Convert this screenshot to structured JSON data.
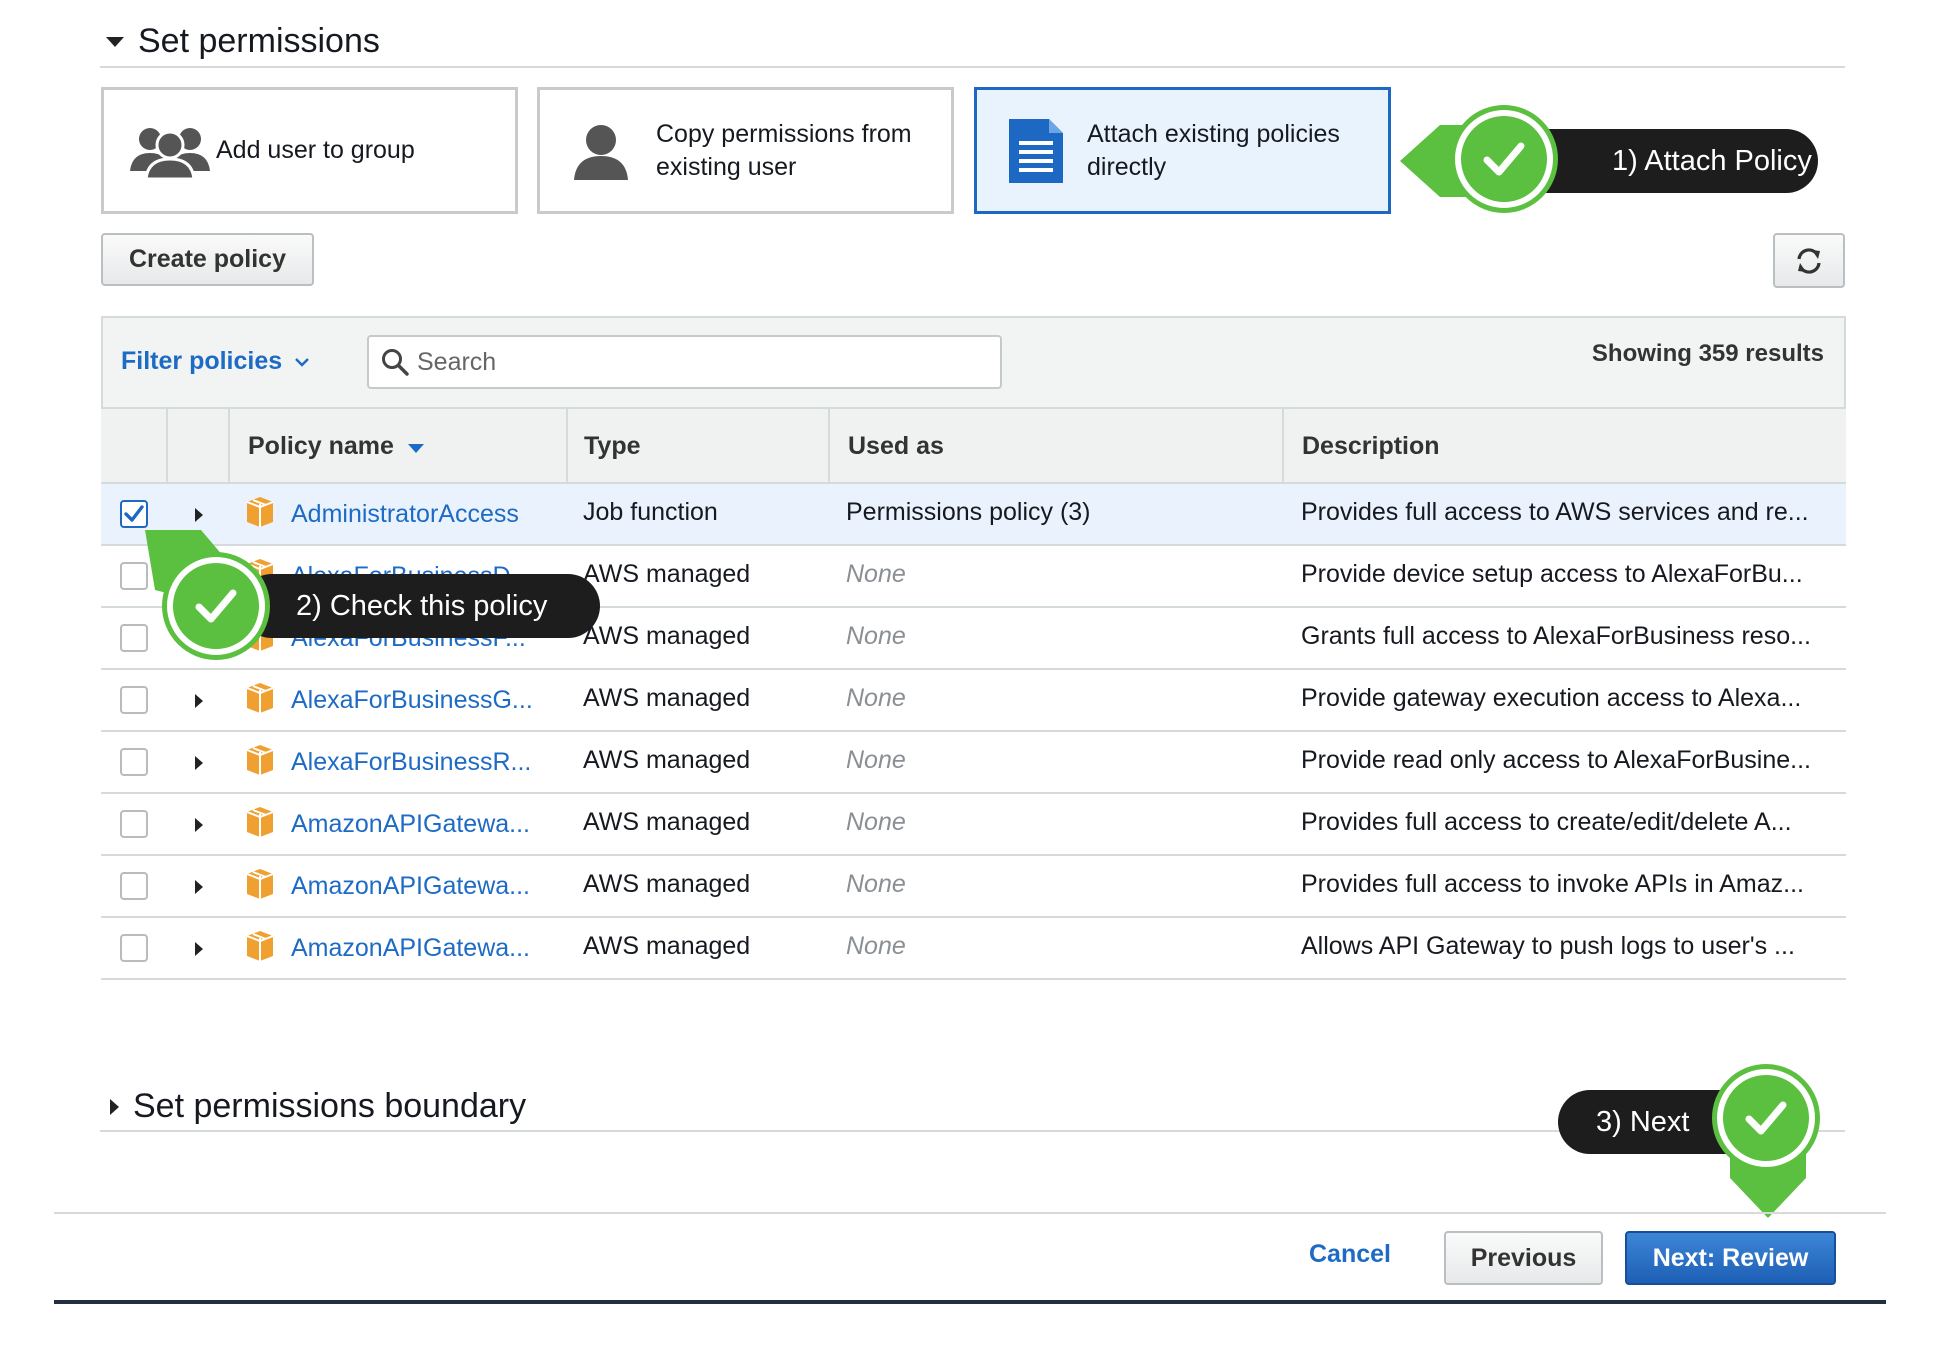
{
  "set_permissions": {
    "title": "Set permissions",
    "options": [
      {
        "label": "Add user to group",
        "icon": "group-icon",
        "selected": false
      },
      {
        "label_line1": "Copy permissions from",
        "label_line2": "existing user",
        "icon": "user-icon",
        "selected": false
      },
      {
        "label_line1": "Attach existing policies",
        "label_line2": "directly",
        "icon": "document-icon",
        "selected": true
      }
    ]
  },
  "toolbar": {
    "create_policy_label": "Create policy",
    "refresh_icon": "refresh-icon"
  },
  "filter": {
    "filter_label": "Filter policies",
    "search_placeholder": "Search",
    "results_text": "Showing 359 results"
  },
  "table": {
    "columns": [
      "Policy name",
      "Type",
      "Used as",
      "Description"
    ],
    "rows": [
      {
        "checked": true,
        "name": "AdministratorAccess",
        "type": "Job function",
        "used_as": "Permissions policy (3)",
        "used_none": false,
        "description": "Provides full access to AWS services and re..."
      },
      {
        "checked": false,
        "name": "AlexaForBusinessD...",
        "type": "AWS managed",
        "used_as": "None",
        "used_none": true,
        "description": "Provide device setup access to AlexaForBu..."
      },
      {
        "checked": false,
        "name": "AlexaForBusinessF...",
        "type": "AWS managed",
        "used_as": "None",
        "used_none": true,
        "description": "Grants full access to AlexaForBusiness reso..."
      },
      {
        "checked": false,
        "name": "AlexaForBusinessG...",
        "type": "AWS managed",
        "used_as": "None",
        "used_none": true,
        "description": "Provide gateway execution access to Alexa..."
      },
      {
        "checked": false,
        "name": "AlexaForBusinessR...",
        "type": "AWS managed",
        "used_as": "None",
        "used_none": true,
        "description": "Provide read only access to AlexaForBusine..."
      },
      {
        "checked": false,
        "name": "AmazonAPIGatewa...",
        "type": "AWS managed",
        "used_as": "None",
        "used_none": true,
        "description": "Provides full access to create/edit/delete A..."
      },
      {
        "checked": false,
        "name": "AmazonAPIGatewa...",
        "type": "AWS managed",
        "used_as": "None",
        "used_none": true,
        "description": "Provides full access to invoke APIs in Amaz..."
      },
      {
        "checked": false,
        "name": "AmazonAPIGatewa...",
        "type": "AWS managed",
        "used_as": "None",
        "used_none": true,
        "description": "Allows API Gateway to push logs to user's ..."
      }
    ]
  },
  "boundary": {
    "title": "Set permissions boundary"
  },
  "footer": {
    "cancel_label": "Cancel",
    "previous_label": "Previous",
    "next_label": "Next: Review"
  },
  "callouts": {
    "step1": "1) Attach Policy",
    "step2": "2) Check this policy",
    "step3": "3) Next"
  },
  "colors": {
    "accent_blue": "#1d68c2",
    "callout_green": "#5bbf3f",
    "policy_orange": "#f0a030"
  }
}
